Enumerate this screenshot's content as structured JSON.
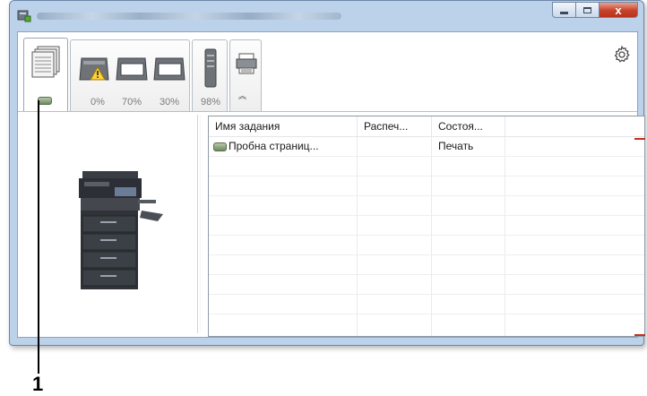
{
  "window": {
    "title": "",
    "buttons": {
      "minimize": "minimize",
      "maximize": "maximize",
      "close": "x"
    }
  },
  "toolbar": {
    "tabs": [
      {
        "id": "jobs",
        "label": "",
        "active": true
      },
      {
        "id": "toners",
        "levels": [
          "0%",
          "70%",
          "30%"
        ],
        "warning_on_first": true
      },
      {
        "id": "waste",
        "levels": [
          "98%"
        ]
      },
      {
        "id": "device",
        "label": ""
      }
    ],
    "collapse_glyph": "︽",
    "settings_icon": "gear-icon"
  },
  "job_list": {
    "columns": [
      "Имя задания",
      "Распеч...",
      "Состоя..."
    ],
    "rows": [
      {
        "name": "Пробна страниц...",
        "printed": "",
        "status": "Печать"
      }
    ]
  },
  "callout": {
    "number": "1"
  },
  "colors": {
    "accent": "#c03020",
    "frame": "#bcd2ea",
    "close": "#c8412a"
  }
}
